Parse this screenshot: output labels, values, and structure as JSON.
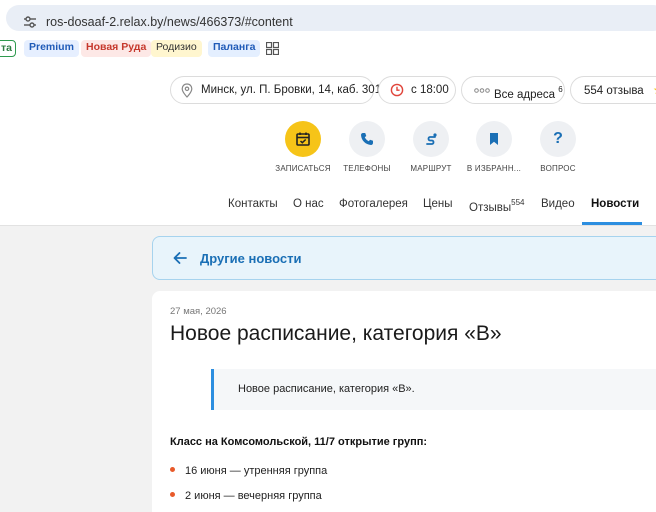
{
  "browser": {
    "url": "ros-dosaaf-2.relax.by/news/466373/#content",
    "bookmarks": [
      "та",
      "Premium",
      "Новая Руда",
      "Родизио",
      "Паланга"
    ],
    "icons": [
      "tune-icon",
      "apps-grid-icon"
    ]
  },
  "header": {
    "address": "Минск, ул. П. Бровки, 14, каб. 301",
    "hours": "с 18:00",
    "all_addresses": "Все адреса",
    "all_addresses_count": "6",
    "reviews": "554 отзыва"
  },
  "actions": [
    {
      "label": "ЗАПИСАТЬСЯ",
      "icon": "calendar-icon"
    },
    {
      "label": "ТЕЛЕФОНЫ",
      "icon": "phone-icon"
    },
    {
      "label": "МАРШРУТ",
      "icon": "route-icon"
    },
    {
      "label": "В ИЗБРАНН...",
      "icon": "bookmark-icon"
    },
    {
      "label": "ВОПРОС",
      "icon": "question-icon"
    }
  ],
  "tabs": [
    {
      "label": "Контакты"
    },
    {
      "label": "О нас"
    },
    {
      "label": "Фотогалерея"
    },
    {
      "label": "Цены"
    },
    {
      "label": "Отзывы",
      "count": "554"
    },
    {
      "label": "Видео"
    },
    {
      "label": "Новости",
      "active": true
    }
  ],
  "back_link": "Другие новости",
  "article": {
    "date": "27 мая, 2026",
    "title": "Новое расписание, категория «В»",
    "quote": "Новое расписание, категория «В».",
    "subhead": "Класс на Комсомольской, 11/7 открытие групп:",
    "items": [
      "16 июня — утренняя группа",
      "2 июня — вечерняя группа"
    ]
  },
  "colors": {
    "accent": "#2c8ee0",
    "action_primary": "#f6c418",
    "bullet": "#e85a2a",
    "back_panel_bg": "#e8f4fb"
  }
}
